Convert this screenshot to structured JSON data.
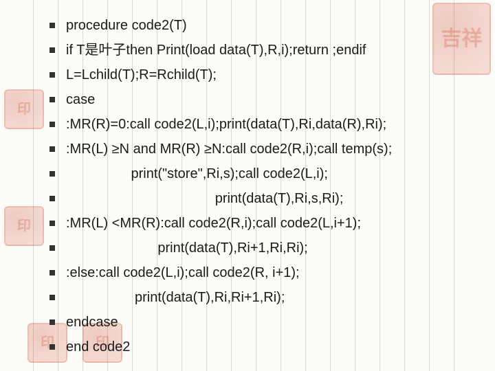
{
  "slide": {
    "lines": [
      "procedure code2(T)",
      "if T是叶子then Print(load data(T),R,i);return ;endif",
      "L=Lchild(T);R=Rchild(T);",
      "case",
      ":MR(R)=0:call code2(L,i);print(data(T),Ri,data(R),Ri);",
      ":MR(L) ≥N and MR(R) ≥N:call code2(R,i);call temp(s);",
      "                 print(\"store\",Ri,s);call code2(L,i);",
      "                                       print(data(T),Ri,s,Ri);",
      ":MR(L) <MR(R):call code2(R,i);call code2(L,i+1);",
      "                        print(data(T),Ri+1,Ri,Ri);",
      ":else:call code2(L,i);call code2(R, i+1);",
      "                  print(data(T),Ri,Ri+1,Ri);",
      "endcase",
      "end code2"
    ]
  },
  "decor": {
    "seal_text_small": "印",
    "seal_text_big": "吉祥"
  }
}
